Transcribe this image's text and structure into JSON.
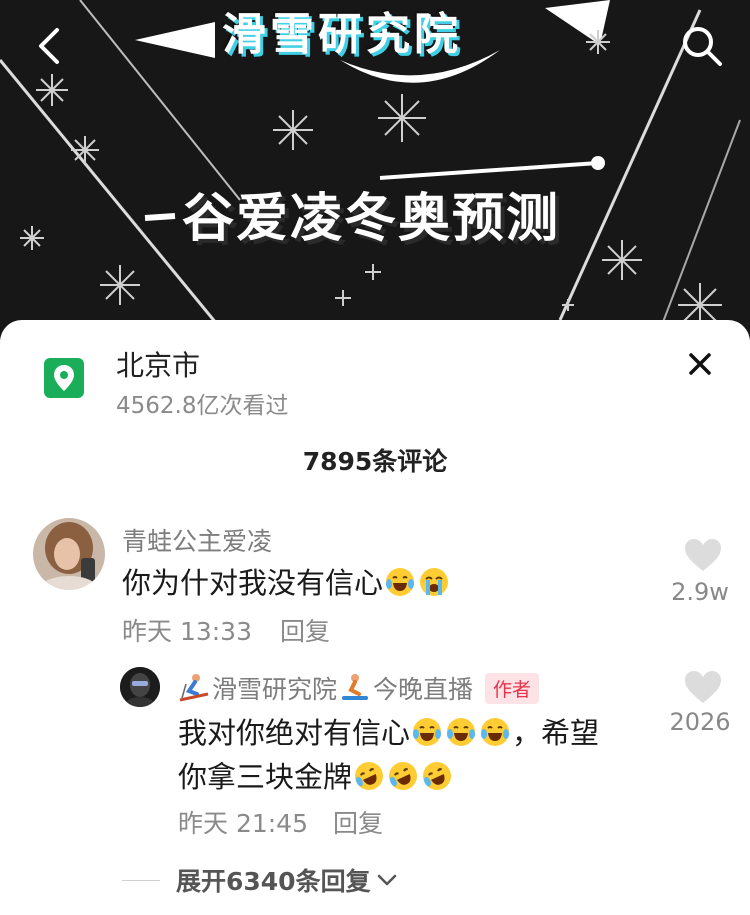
{
  "video": {
    "banner_text": "滑雪研究院",
    "title": "谷爱凌冬奥预测"
  },
  "header": {
    "back_icon": "chevron-left-icon",
    "search_icon": "search-icon"
  },
  "location": {
    "name": "北京市",
    "views": "4562.8亿次看过",
    "icon": "location-pin-icon"
  },
  "comments_count": "7895条评论",
  "comments": [
    {
      "user": "青蛙公主爱凌",
      "text": "你为什对我没有信心",
      "emojis": [
        "laughing-crying-emoji",
        "loudly-crying-emoji"
      ],
      "time": "昨天 13:33",
      "reply_label": "回复",
      "likes": "2.9w"
    }
  ],
  "reply": {
    "user_prefix_emoji": "skier-emoji",
    "user_name": "滑雪研究院",
    "user_mid_emoji": "snowboarder-emoji",
    "user_suffix": "今晚直播",
    "badge": "作者",
    "line1": "我对你绝对有信心",
    "line1_emojis": [
      "laughing-crying-emoji",
      "laughing-crying-emoji",
      "laughing-crying-emoji"
    ],
    "line1_tail": "，希望",
    "line2": "你拿三块金牌",
    "line2_emojis": [
      "rolling-laughing-emoji",
      "rolling-laughing-emoji",
      "rolling-laughing-emoji"
    ],
    "time": "昨天 21:45",
    "reply_label": "回复",
    "likes": "2026"
  },
  "expand_label": "展开6340条回复",
  "colors": {
    "location_green": "#1aae5a",
    "author_badge_bg": "#fde3e6",
    "author_badge_text": "#e8344b",
    "banner_accent": "#3fd0e6"
  }
}
